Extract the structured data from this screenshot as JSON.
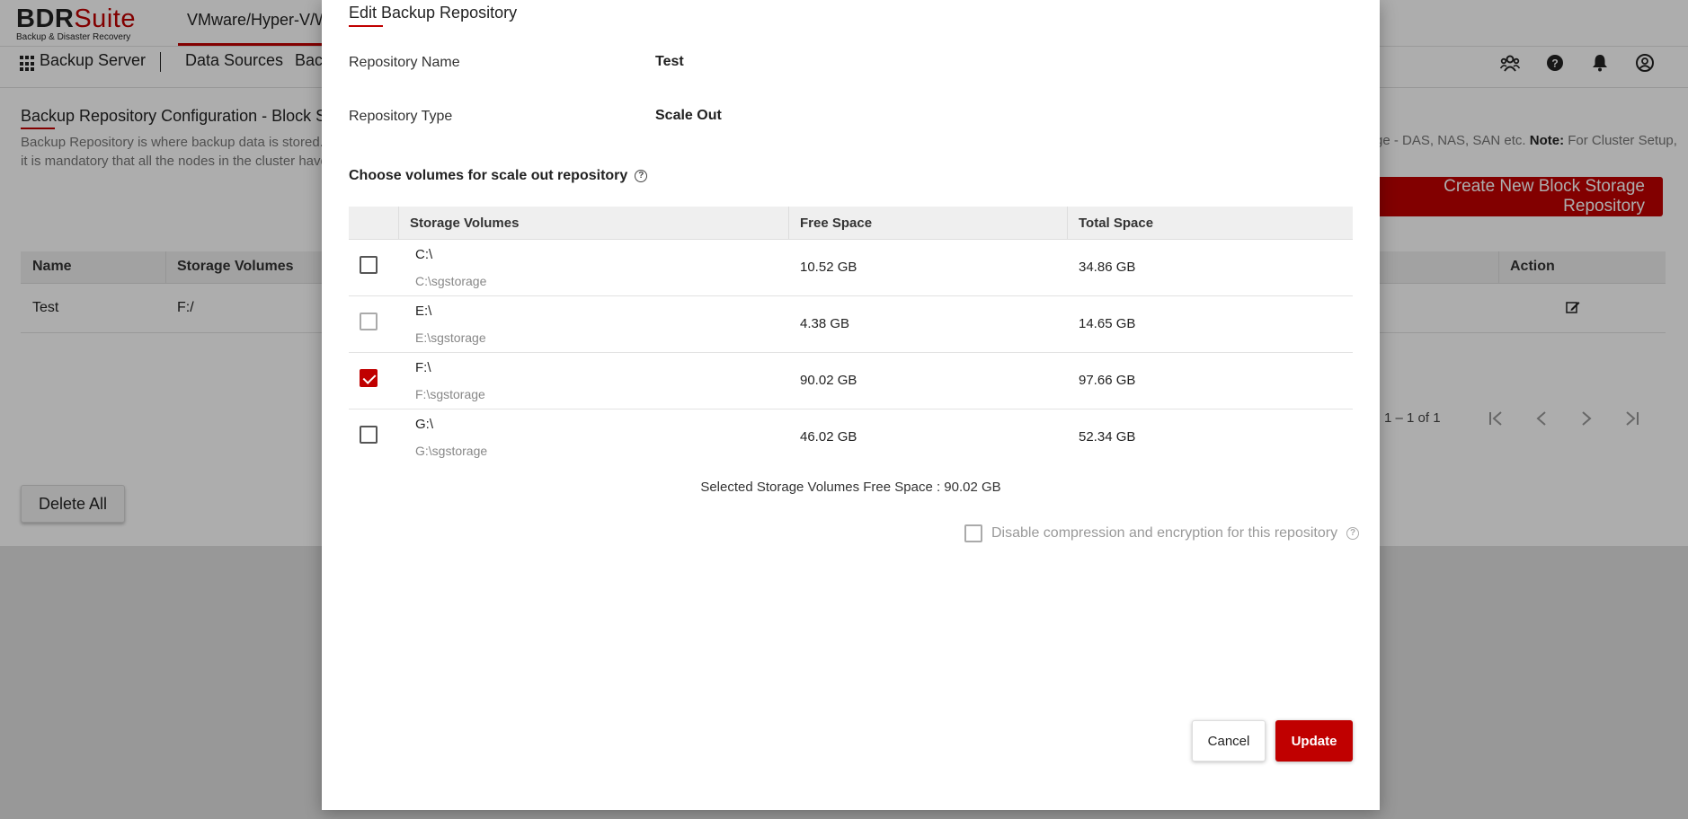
{
  "app": {
    "logo_brand_dark": "BDR",
    "logo_brand_red": "Suite",
    "logo_subtitle": "Backup & Disaster Recovery",
    "top_tab": "VMware/Hyper-V/W"
  },
  "nav": {
    "backup_server": "Backup Server",
    "data_sources": "Data Sources",
    "backup_partial": "Bac"
  },
  "page": {
    "title": "Backup Repository Configuration - Block Sto",
    "desc_line1": "Backup Repository is where backup data is stored. T",
    "desc_line2": "it is mandatory that all the nodes in the cluster have",
    "desc_right_line1": "ge - DAS, NAS, SAN etc.",
    "desc_right_note_label": "Note:",
    "desc_right_note_text": " For Cluster Setup,",
    "create_button": "Create New Block Storage Repository",
    "table_headers": {
      "name": "Name",
      "storage_volumes": "Storage Volumes",
      "action": "Action"
    },
    "rows": [
      {
        "name": "Test",
        "storage_volumes": "F:/"
      }
    ],
    "pager_text": "1 – 1 of 1",
    "delete_all": "Delete All"
  },
  "modal": {
    "title": "Edit Backup Repository",
    "repo_name_label": "Repository Name",
    "repo_name_value": "Test",
    "repo_type_label": "Repository Type",
    "repo_type_value": "Scale Out",
    "choose_label": "Choose volumes for scale out repository",
    "columns": {
      "volumes": "Storage Volumes",
      "free": "Free Space",
      "total": "Total Space"
    },
    "volumes": [
      {
        "drive": "C:\\",
        "path": "C:\\sgstorage",
        "free": "10.52 GB",
        "total": "34.86 GB",
        "checked": false
      },
      {
        "drive": "E:\\",
        "path": "E:\\sgstorage",
        "free": "4.38 GB",
        "total": "14.65 GB",
        "checked": false
      },
      {
        "drive": "F:\\",
        "path": "F:\\sgstorage",
        "free": "90.02 GB",
        "total": "97.66 GB",
        "checked": true
      },
      {
        "drive": "G:\\",
        "path": "G:\\sgstorage",
        "free": "46.02 GB",
        "total": "52.34 GB",
        "checked": false
      }
    ],
    "selected_free": "Selected Storage Volumes Free Space : 90.02 GB",
    "disable_label": "Disable compression and encryption for this repository",
    "cancel": "Cancel",
    "update": "Update"
  },
  "colors": {
    "brand_red": "#c00000"
  }
}
